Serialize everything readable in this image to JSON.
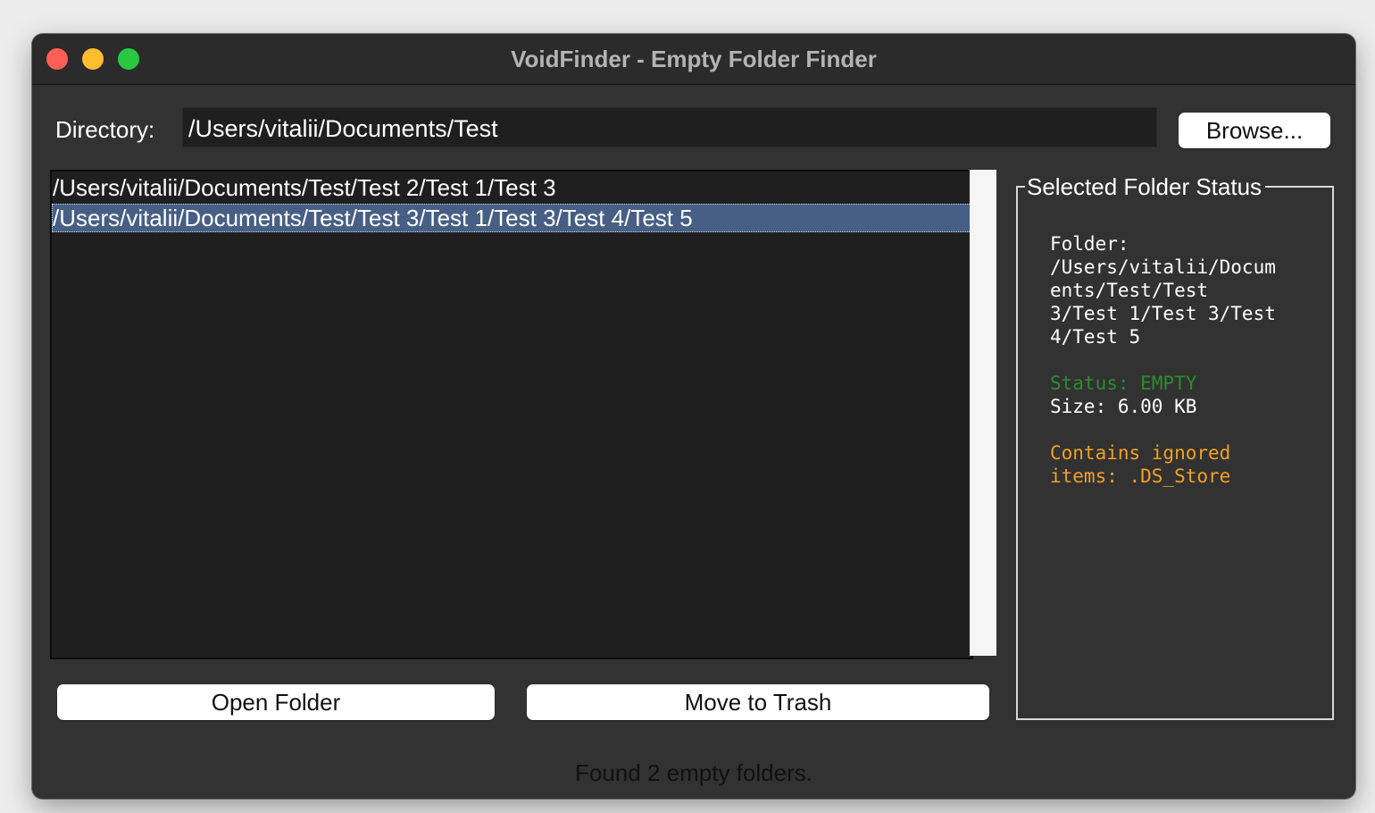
{
  "window": {
    "title": "VoidFinder - Empty Folder Finder"
  },
  "directory": {
    "label": "Directory:",
    "value": "/Users/vitalii/Documents/Test",
    "browse_label": "Browse..."
  },
  "results": {
    "items": [
      "/Users/vitalii/Documents/Test/Test 2/Test 1/Test 3",
      "/Users/vitalii/Documents/Test/Test 3/Test 1/Test 3/Test 4/Test 5"
    ],
    "selected_index": 1
  },
  "actions": {
    "open_label": "Open Folder",
    "trash_label": "Move to Trash"
  },
  "status_panel": {
    "title": "Selected Folder Status",
    "folder_lines": [
      "Folder:",
      "/Users/vitalii/Docum",
      "ents/Test/Test",
      "3/Test 1/Test 3/Test",
      "4/Test 5"
    ],
    "status_text": "Status: EMPTY",
    "size_text": "Size: 6.00 KB",
    "ignored_lines": [
      "Contains ignored",
      "items: .DS_Store"
    ],
    "colors": {
      "status": "#2e8b2e",
      "ignored": "#f0a020"
    }
  },
  "footer": {
    "message": "Found 2 empty folders."
  }
}
